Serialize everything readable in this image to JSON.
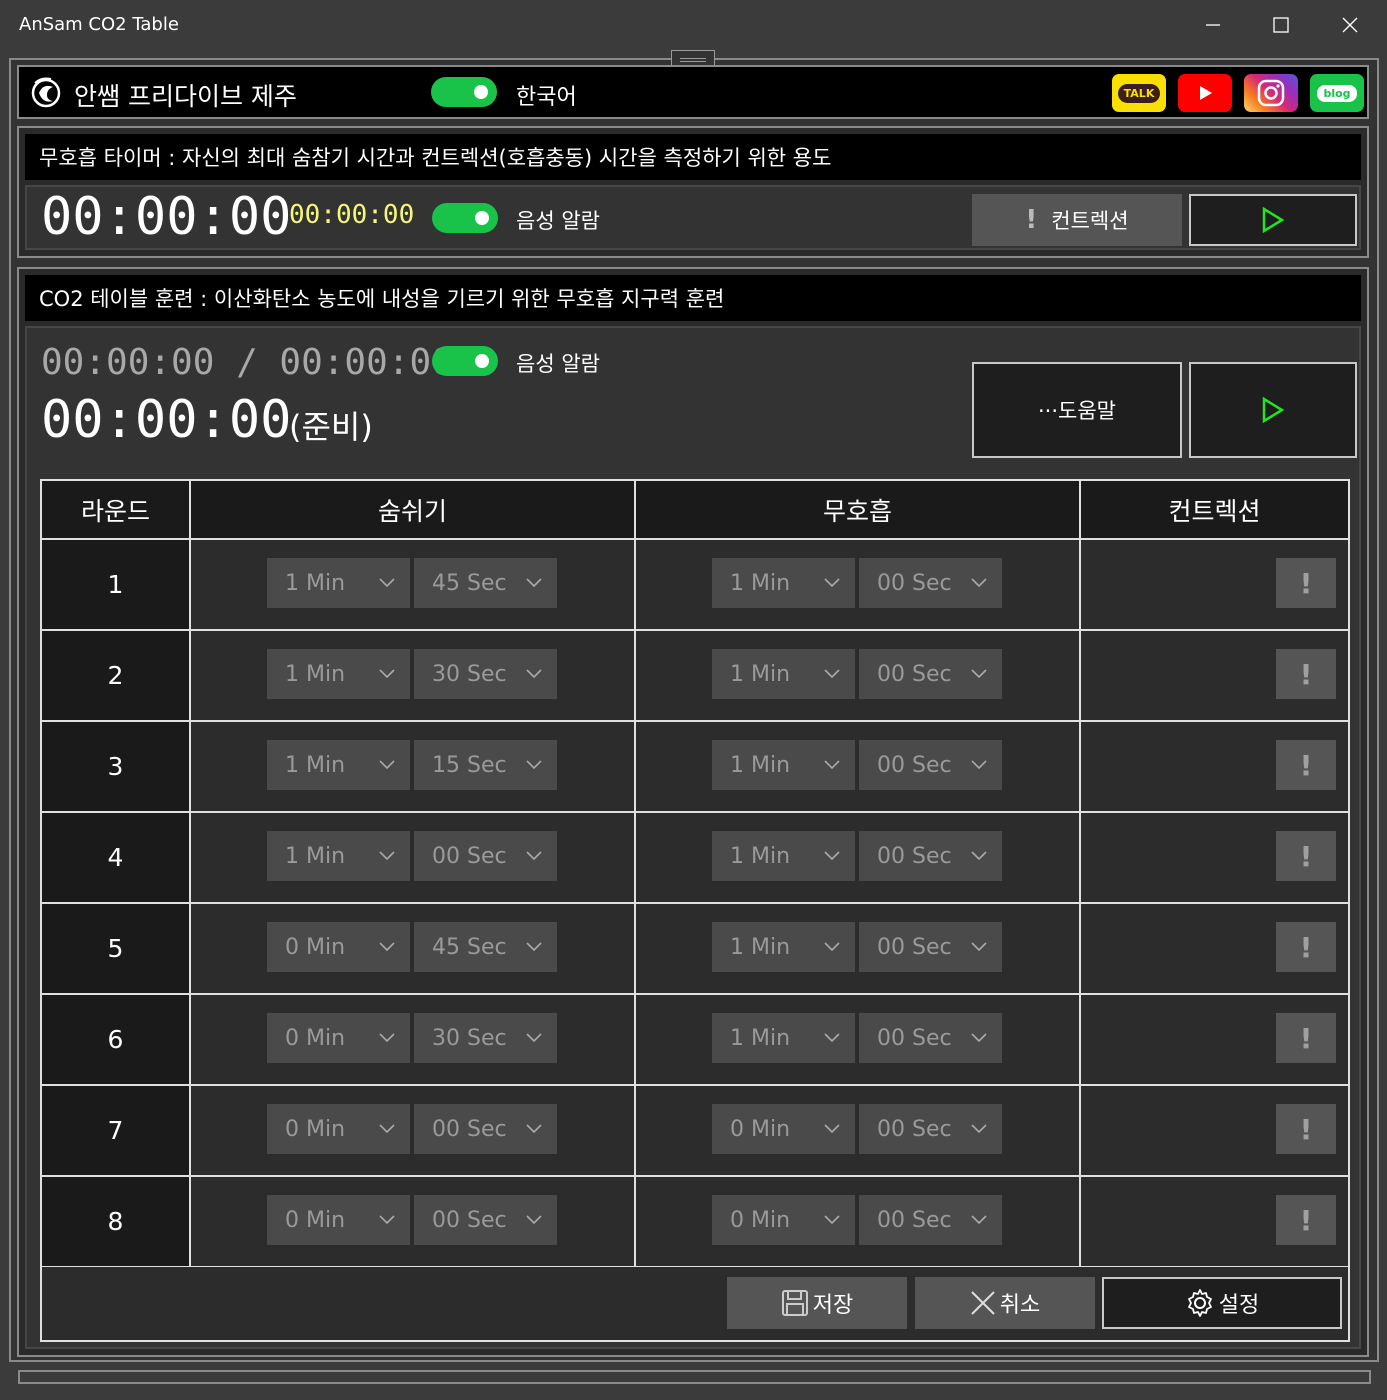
{
  "window": {
    "title": "AnSam CO2 Table",
    "minimize_icon": "minimize-icon",
    "maximize_icon": "maximize-icon",
    "close_icon": "close-icon"
  },
  "header": {
    "app_name": "안쌤 프리다이브 제주",
    "logo_icon": "dragon-logo-icon",
    "language_toggle_on": true,
    "language_label": "한국어",
    "social": [
      {
        "name": "kakaotalk",
        "label": "TALK",
        "color": "#f9e000"
      },
      {
        "name": "youtube",
        "label": "",
        "color": "#ff0000"
      },
      {
        "name": "instagram",
        "label": "",
        "color": "#d6249f"
      },
      {
        "name": "blog",
        "label": "blog",
        "color": "#19c34a"
      }
    ]
  },
  "timer_section": {
    "title": "무호흡 타이머 : 자신의 최대 숨참기 시간과 컨트렉션(호흡충동) 시간을 측정하기 위한 용도",
    "main_time": "00:00:00",
    "sub_time": "00:00:00",
    "sub_time_color": "#f6f67a",
    "voice_alarm_on": true,
    "voice_alarm_label": "음성 알람",
    "contraction_button": "컨트렉션",
    "contraction_icon": "exclamation-icon",
    "play_icon": "play-icon"
  },
  "co2_section": {
    "title": "CO2 테이블 훈련 : 이산화탄소 농도에 내성을 기르기 위한 무호흡 지구력 훈련",
    "progress_time": "00:00:00 / 00:00:00",
    "voice_alarm_on": true,
    "voice_alarm_label": "음성 알람",
    "current_time": "00:00:00",
    "phase_label": "(준비)",
    "help_button": "···도움말",
    "play_icon": "play-icon"
  },
  "table": {
    "headers": [
      "라운드",
      "숨쉬기",
      "무호흡",
      "컨트렉션"
    ],
    "rows": [
      {
        "round": "1",
        "breathe_min": "1 Min",
        "breathe_sec": "45 Sec",
        "hold_min": "1 Min",
        "hold_sec": "00 Sec"
      },
      {
        "round": "2",
        "breathe_min": "1 Min",
        "breathe_sec": "30 Sec",
        "hold_min": "1 Min",
        "hold_sec": "00 Sec"
      },
      {
        "round": "3",
        "breathe_min": "1 Min",
        "breathe_sec": "15 Sec",
        "hold_min": "1 Min",
        "hold_sec": "00 Sec"
      },
      {
        "round": "4",
        "breathe_min": "1 Min",
        "breathe_sec": "00 Sec",
        "hold_min": "1 Min",
        "hold_sec": "00 Sec"
      },
      {
        "round": "5",
        "breathe_min": "0 Min",
        "breathe_sec": "45 Sec",
        "hold_min": "1 Min",
        "hold_sec": "00 Sec"
      },
      {
        "round": "6",
        "breathe_min": "0 Min",
        "breathe_sec": "30 Sec",
        "hold_min": "1 Min",
        "hold_sec": "00 Sec"
      },
      {
        "round": "7",
        "breathe_min": "0 Min",
        "breathe_sec": "00 Sec",
        "hold_min": "0 Min",
        "hold_sec": "00 Sec"
      },
      {
        "round": "8",
        "breathe_min": "0 Min",
        "breathe_sec": "00 Sec",
        "hold_min": "0 Min",
        "hold_sec": "00 Sec"
      }
    ],
    "contraction_mark": "!"
  },
  "footer": {
    "save_label": "저장",
    "save_icon": "floppy-disk-icon",
    "cancel_label": "취소",
    "cancel_icon": "close-icon",
    "settings_label": "설정",
    "settings_icon": "gear-icon"
  },
  "colors": {
    "toggle_on": "#19c34a",
    "play_green": "#1ee81e",
    "accent_yellow": "#f6f67a"
  }
}
